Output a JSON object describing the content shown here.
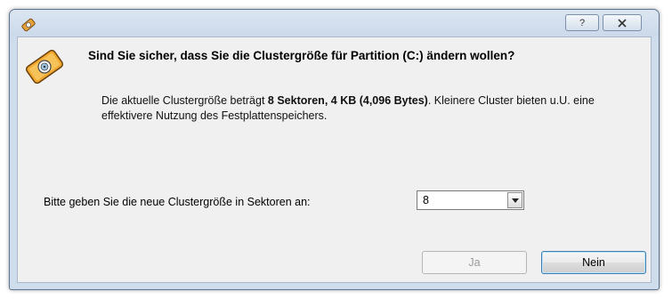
{
  "window": {
    "help_glyph": "?",
    "close_glyph": "X"
  },
  "dialog": {
    "question": "Sind Sie sicher, dass Sie die Clustergröße für Partition (C:) ändern wollen?",
    "info_prefix": "Die aktuelle Clustergröße beträgt ",
    "info_bold": "8 Sektoren, 4 KB (4,096 Bytes)",
    "info_suffix": ". Kleinere Cluster bieten u.U. eine effektivere Nutzung des Festplattenspeichers.",
    "prompt_label": "Bitte geben Sie die neue Clustergröße in Sektoren an:",
    "cluster_value": "8",
    "yes_label": "Ja",
    "no_label": "Nein"
  }
}
